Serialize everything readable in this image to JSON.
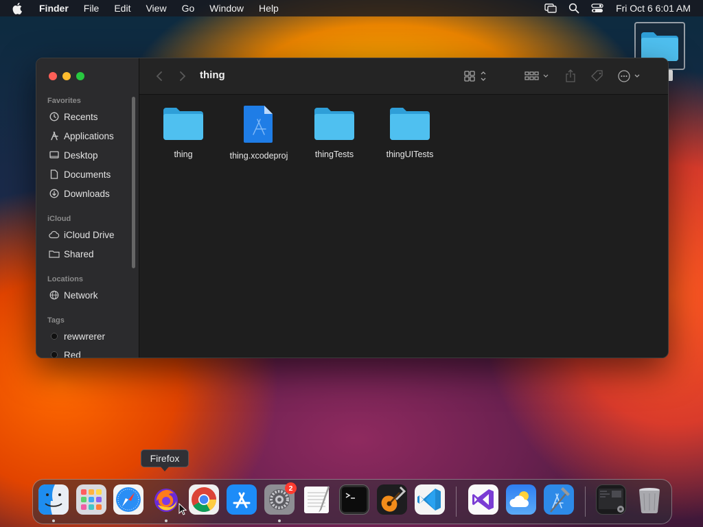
{
  "menubar": {
    "app_name": "Finder",
    "items": [
      "File",
      "Edit",
      "View",
      "Go",
      "Window",
      "Help"
    ],
    "clock": "Fri Oct 6  6:01 AM"
  },
  "window": {
    "title": "thing",
    "sidebar": {
      "favorites_header": "Favorites",
      "favorites": [
        "Recents",
        "Applications",
        "Desktop",
        "Documents",
        "Downloads"
      ],
      "icloud_header": "iCloud",
      "icloud": [
        "iCloud Drive",
        "Shared"
      ],
      "locations_header": "Locations",
      "locations": [
        "Network"
      ],
      "tags_header": "Tags",
      "tags": [
        "rewwrerer",
        "Red"
      ]
    },
    "files": [
      {
        "name": "thing",
        "kind": "folder"
      },
      {
        "name": "thing.xcodeproj",
        "kind": "xcodeproj"
      },
      {
        "name": "thingTests",
        "kind": "folder"
      },
      {
        "name": "thingUITests",
        "kind": "folder"
      }
    ]
  },
  "tooltip": {
    "text": "Firefox"
  },
  "dock": {
    "badge_count": "2",
    "apps": [
      "finder-icon",
      "launchpad-icon",
      "safari-icon",
      "firefox-icon",
      "chrome-icon",
      "app-store-icon",
      "system-settings-icon",
      "textedit-icon",
      "terminal-icon",
      "garageband-icon",
      "vscode-icon",
      "visual-studio-icon",
      "weather-icon",
      "xcode-icon",
      "screenshot-icon",
      "trash-icon"
    ]
  },
  "colors": {
    "folder": "#3fb6ec",
    "accent": "#1e88ff",
    "badge": "#ff3b30"
  }
}
